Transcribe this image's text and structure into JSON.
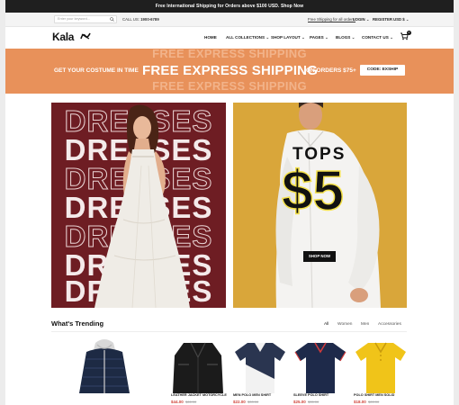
{
  "announcement": "Free International Shipping for Orders above $100 USD. Shop Now",
  "topbar": {
    "search_placeholder": "Enter your keyword...",
    "call_prefix": "CALL US:",
    "call_number": "1900-6789",
    "free_shipping_link": "Free Shipping for all orders!",
    "login": "LOGIN",
    "register": "REGISTER",
    "currency": "USD $"
  },
  "header": {
    "logo": "Kala",
    "nav": [
      "HOME",
      "ALL COLLECTIONS",
      "SHOP LAYOUT",
      "PAGES",
      "BLOGS",
      "CONTACT US"
    ],
    "cart_count": "0"
  },
  "promo": {
    "ghost_text": "FREE EXPRESS SHIPPING",
    "left_text": "GET YOUR COSTUME IN TIME",
    "center_text": "FREE EXPRESS SHIPPING",
    "right_text": "ON ORDERS $75+",
    "code": "CODE: EXSHIP"
  },
  "banner_left": {
    "word": "DRESSES",
    "rows": [
      "outline",
      "solid",
      "outline",
      "solid",
      "outline",
      "solid",
      "outline"
    ]
  },
  "banner_right": {
    "label": "TOPS",
    "price": "$5",
    "button": "SHOP NOW"
  },
  "trending": {
    "title": "What's Trending",
    "filters": [
      "All",
      "Women",
      "Men",
      "Accessories"
    ]
  },
  "products": [
    {
      "name": "",
      "price": "$--.--",
      "old_price": "$--.--",
      "color": "#1d2a44"
    },
    {
      "name": "LEATHER JACKET MOTORCYCLE",
      "price": "$44.00",
      "old_price": "$66.00",
      "color": "#1b1b1b"
    },
    {
      "name": "MEN POLO MEN SHIRT",
      "price": "$22.00",
      "old_price": "$33.00",
      "color": "#2a3550"
    },
    {
      "name": "SLEEVE POLO SHIRT",
      "price": "$25.00",
      "old_price": "$35.00",
      "color": "#1e2a4a"
    },
    {
      "name": "POLO SHIRT MEN SOLID",
      "price": "$18.00",
      "old_price": "$28.00",
      "color": "#f0c419"
    }
  ],
  "colors": {
    "promo_bg": "#e8915a",
    "dresses_bg": "#6e1d23",
    "tops_bg": "#d9a63a"
  }
}
